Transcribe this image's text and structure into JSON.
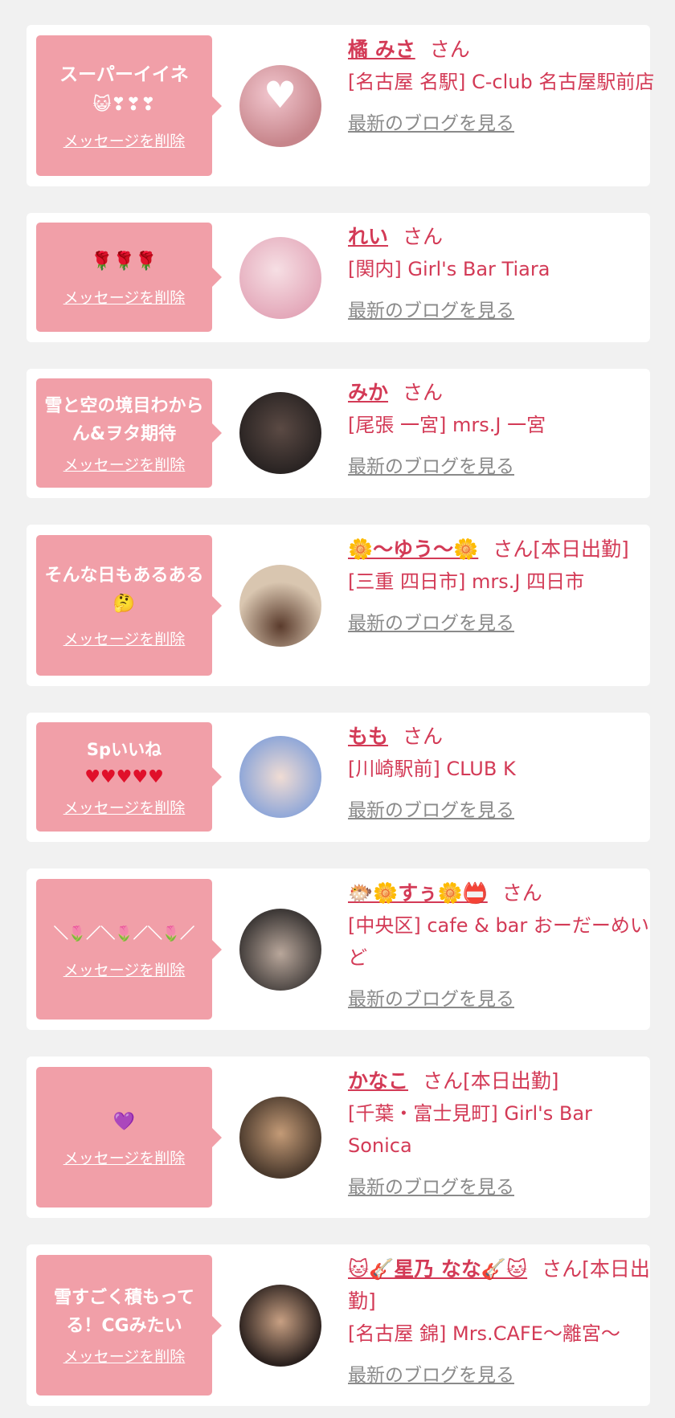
{
  "common": {
    "delete_label": "メッセージを削除",
    "blog_label": "最新のブログを見る",
    "san": "さん"
  },
  "items": [
    {
      "message": "スーパーイイネ",
      "message_emoji": "😺❣❣❣",
      "name": "橘 みさ",
      "suffix": "さん",
      "shop": "[名古屋 名駅] C-club 名古屋駅前店",
      "avatar_colors": [
        "#c7858b",
        "#f2c7cf"
      ]
    },
    {
      "message": "",
      "message_emoji": "🌹🌹🌹",
      "name": "れい",
      "suffix": "さん",
      "shop": "[関内] Girl's Bar Tiara",
      "avatar_colors": [
        "#e3a6b8",
        "#f6dfe4"
      ]
    },
    {
      "message": "雪と空の境目わからん&ヲタ期待",
      "message_emoji": "",
      "name": "みか",
      "suffix": "さん",
      "shop": "[尾張 一宮] mrs.J 一宮",
      "avatar_colors": [
        "#2a2423",
        "#5b4a44"
      ]
    },
    {
      "message": "そんな日もあるある",
      "message_emoji": "🤔",
      "name": "🌼〜ゆう〜🌼",
      "suffix": "さん[本日出勤]",
      "shop": "[三重 四日市] mrs.J 四日市",
      "avatar_colors": [
        "#d9c6b0",
        "#5a3b2c"
      ]
    },
    {
      "message": "Spいいね",
      "message_emoji": "♥♥♥♥♥",
      "name": "もも",
      "suffix": "さん",
      "shop": "[川崎駅前] CLUB K",
      "avatar_colors": [
        "#8aa4d8",
        "#f0dcd4"
      ]
    },
    {
      "message": "",
      "message_emoji": "＼🌷／＼🌷／＼🌷／",
      "name": "🐡🌼すぅ🌼📛",
      "suffix": "さん",
      "shop": "[中央区] cafe & bar おーだーめいど",
      "avatar_colors": [
        "#3f3a38",
        "#b9a79b"
      ]
    },
    {
      "message": "",
      "message_emoji": "💜",
      "name": "かなこ",
      "suffix": "さん[本日出勤]",
      "shop": "[千葉・富士見町] Girl's Bar Sonica",
      "avatar_colors": [
        "#4b3a2d",
        "#c49b77"
      ]
    },
    {
      "message": "雪すごく積もってる！CGみたい",
      "message_emoji": "",
      "name": "🐱🎸星乃 なな🎸🐱",
      "suffix": "さん[本日出勤]",
      "shop": "[名古屋 錦] Mrs.CAFE〜離宮〜",
      "avatar_colors": [
        "#2b211e",
        "#c8a083"
      ]
    }
  ]
}
